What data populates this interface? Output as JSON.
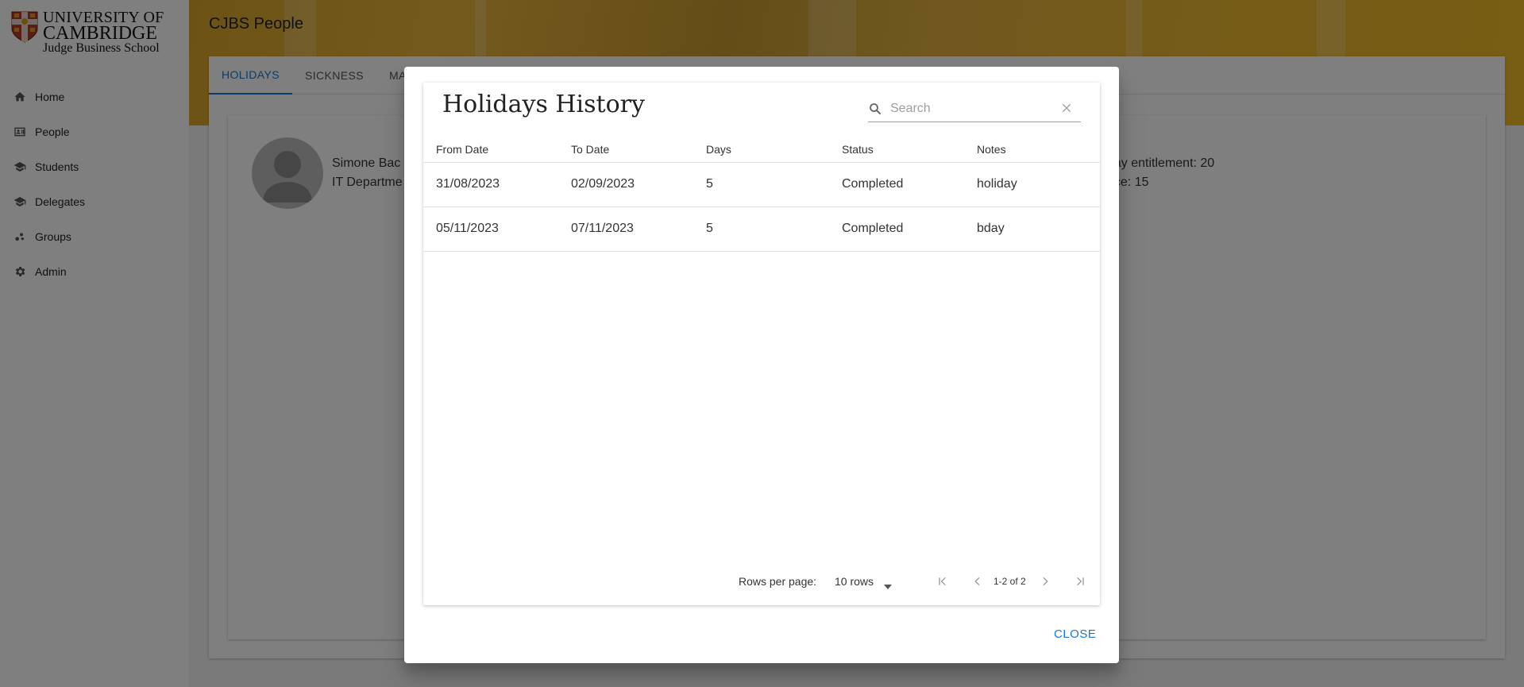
{
  "sidebar": {
    "logo": {
      "line1": "UNIVERSITY OF",
      "line2": "CAMBRIDGE",
      "line3": "Judge Business School"
    },
    "items": [
      {
        "label": "Home",
        "icon": "home-icon"
      },
      {
        "label": "People",
        "icon": "badge-icon"
      },
      {
        "label": "Students",
        "icon": "school-icon"
      },
      {
        "label": "Delegates",
        "icon": "school-icon"
      },
      {
        "label": "Groups",
        "icon": "groups-icon"
      },
      {
        "label": "Admin",
        "icon": "gear-icon"
      }
    ]
  },
  "header": {
    "title": "CJBS People"
  },
  "tabs": [
    "HOLIDAYS",
    "SICKNESS",
    "MA"
  ],
  "profile": {
    "name": "Simone Bac",
    "department": "IT Departme",
    "entitlement": "day entitlement: 20",
    "balance": "nce: 15"
  },
  "dialog": {
    "title": "Holidays History",
    "search_placeholder": "Search",
    "columns": [
      "From Date",
      "To Date",
      "Days",
      "Status",
      "Notes"
    ],
    "rows": [
      {
        "from": "31/08/2023",
        "to": "02/09/2023",
        "days": "5",
        "status": "Completed",
        "notes": "holiday"
      },
      {
        "from": "05/11/2023",
        "to": "07/11/2023",
        "days": "5",
        "status": "Completed",
        "notes": "bday"
      }
    ],
    "pagination": {
      "rows_per_page_label": "Rows per page:",
      "rows_per_page_value": "10 rows",
      "count": "1-2 of 2"
    },
    "close_label": "CLOSE"
  },
  "colors": {
    "accent": "#1976d2",
    "brand_gold": "#e8b43a"
  }
}
